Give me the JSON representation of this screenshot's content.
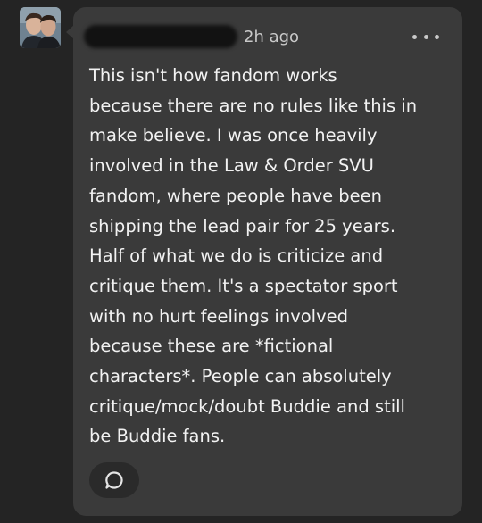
{
  "comment": {
    "timestamp": "2h ago",
    "body": "This isn't how fandom works\nbecause there are no rules like this in\nmake believe. I was once heavily\ninvolved in the Law & Order SVU\nfandom, where people have been\nshipping the lead pair for 25 years.\nHalf of what we do is criticize and\ncritique them. It's a spectator sport\nwith no hurt feelings involved\nbecause these are *fictional\ncharacters*. People can absolutely\ncritique/mock/doubt Buddie and still\nbe Buddie fans.",
    "more_icon": "more-horizontal-icon",
    "reply_icon": "speech-bubble-icon"
  },
  "colors": {
    "background": "#242424",
    "bubble": "#3a3a3a",
    "text": "#f2f2f2",
    "meta": "#c9c9c9"
  }
}
